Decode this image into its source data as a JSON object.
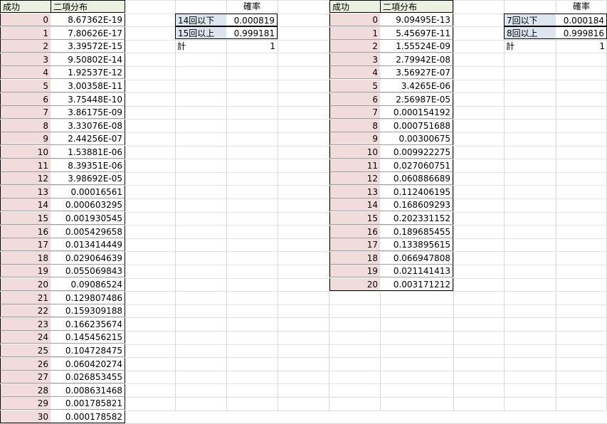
{
  "left_table": {
    "col_success": "成功",
    "col_binomial": "二項分布",
    "rows": [
      {
        "n": "0",
        "v": "8.67362E-19"
      },
      {
        "n": "1",
        "v": "7.80626E-17"
      },
      {
        "n": "2",
        "v": "3.39572E-15"
      },
      {
        "n": "3",
        "v": "9.50802E-14"
      },
      {
        "n": "4",
        "v": "1.92537E-12"
      },
      {
        "n": "5",
        "v": "3.00358E-11"
      },
      {
        "n": "6",
        "v": "3.75448E-10"
      },
      {
        "n": "7",
        "v": "3.86175E-09"
      },
      {
        "n": "8",
        "v": "3.33076E-08"
      },
      {
        "n": "9",
        "v": "2.44256E-07"
      },
      {
        "n": "10",
        "v": "1.53881E-06"
      },
      {
        "n": "11",
        "v": "8.39351E-06"
      },
      {
        "n": "12",
        "v": "3.98692E-05"
      },
      {
        "n": "13",
        "v": "0.00016561"
      },
      {
        "n": "14",
        "v": "0.000603295"
      },
      {
        "n": "15",
        "v": "0.001930545"
      },
      {
        "n": "16",
        "v": "0.005429658"
      },
      {
        "n": "17",
        "v": "0.013414449"
      },
      {
        "n": "18",
        "v": "0.029064639"
      },
      {
        "n": "19",
        "v": "0.055069843"
      },
      {
        "n": "20",
        "v": "0.09086524"
      },
      {
        "n": "21",
        "v": "0.129807486"
      },
      {
        "n": "22",
        "v": "0.159309188"
      },
      {
        "n": "23",
        "v": "0.166235674"
      },
      {
        "n": "24",
        "v": "0.145456215"
      },
      {
        "n": "25",
        "v": "0.104728475"
      },
      {
        "n": "26",
        "v": "0.060420274"
      },
      {
        "n": "27",
        "v": "0.026853455"
      },
      {
        "n": "28",
        "v": "0.008631468"
      },
      {
        "n": "29",
        "v": "0.001785821"
      },
      {
        "n": "30",
        "v": "0.000178582"
      }
    ]
  },
  "left_prob": {
    "header": "確率",
    "row1_label": "14回以下",
    "row1_value": "0.000819",
    "row2_label": "15回以上",
    "row2_value": "0.999181",
    "total_label": "計",
    "total_value": "1"
  },
  "right_table": {
    "col_success": "成功",
    "col_binomial": "二項分布",
    "rows": [
      {
        "n": "0",
        "v": "9.09495E-13"
      },
      {
        "n": "1",
        "v": "5.45697E-11"
      },
      {
        "n": "2",
        "v": "1.55524E-09"
      },
      {
        "n": "3",
        "v": "2.79942E-08"
      },
      {
        "n": "4",
        "v": "3.56927E-07"
      },
      {
        "n": "5",
        "v": "3.4265E-06"
      },
      {
        "n": "6",
        "v": "2.56987E-05"
      },
      {
        "n": "7",
        "v": "0.000154192"
      },
      {
        "n": "8",
        "v": "0.000751688"
      },
      {
        "n": "9",
        "v": "0.00300675"
      },
      {
        "n": "10",
        "v": "0.009922275"
      },
      {
        "n": "11",
        "v": "0.027060751"
      },
      {
        "n": "12",
        "v": "0.060886689"
      },
      {
        "n": "13",
        "v": "0.112406195"
      },
      {
        "n": "14",
        "v": "0.168609293"
      },
      {
        "n": "15",
        "v": "0.202331152"
      },
      {
        "n": "16",
        "v": "0.189685455"
      },
      {
        "n": "17",
        "v": "0.133895615"
      },
      {
        "n": "18",
        "v": "0.066947808"
      },
      {
        "n": "19",
        "v": "0.021141413"
      },
      {
        "n": "20",
        "v": "0.003171212"
      }
    ]
  },
  "right_prob": {
    "header": "確率",
    "row1_label": "7回以下",
    "row1_value": "0.000184",
    "row2_label": "8回以上",
    "row2_value": "0.999816",
    "total_label": "計",
    "total_value": "1"
  }
}
